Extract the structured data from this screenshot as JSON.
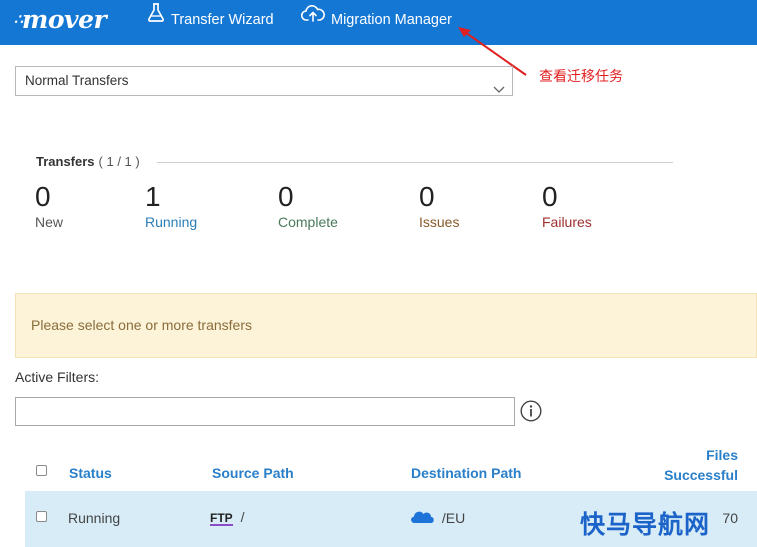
{
  "nav": {
    "logo": "mover",
    "transfer_wizard": "Transfer Wizard",
    "migration_manager": "Migration Manager",
    "icons": [
      "flask-icon",
      "cloud-upload-icon"
    ]
  },
  "annotation": {
    "text": "查看迁移任务",
    "color": "#e02020"
  },
  "transfer_type": {
    "selected": "Normal Transfers"
  },
  "transfers": {
    "title": "Transfers",
    "count": "( 1 / 1 )",
    "stats": [
      {
        "value": "0",
        "label": "New",
        "color": "#555555"
      },
      {
        "value": "1",
        "label": "Running",
        "color": "#2a7fb8"
      },
      {
        "value": "0",
        "label": "Complete",
        "color": "#4a7a5a"
      },
      {
        "value": "0",
        "label": "Issues",
        "color": "#8a5a2a"
      },
      {
        "value": "0",
        "label": "Failures",
        "color": "#a03030"
      }
    ]
  },
  "notice": "Please select one or more transfers",
  "filters": {
    "label": "Active Filters:",
    "value": ""
  },
  "table": {
    "headers": {
      "status": "Status",
      "source": "Source Path",
      "destination": "Destination Path",
      "files_line1": "Files",
      "files_line2": "Successful"
    },
    "rows": [
      {
        "status": "Running",
        "source_type": "FTP",
        "source_path": "/",
        "destination_path": "/EU",
        "files_successful": "70"
      }
    ]
  },
  "watermark": "快马导航网",
  "colors": {
    "topbar": "#1477d4",
    "header_text": "#2a7fc9",
    "row_highlight": "#d7ecf7",
    "notice_bg": "#fcf3d8"
  }
}
